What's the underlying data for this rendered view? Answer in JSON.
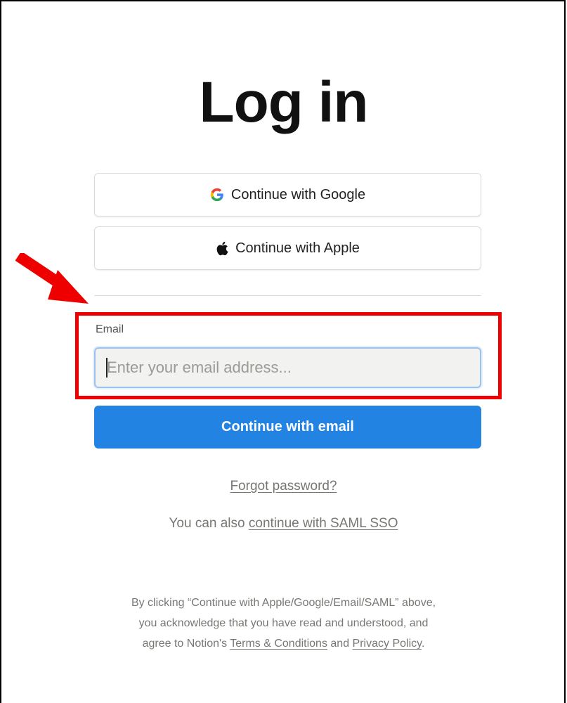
{
  "page": {
    "title": "Log in"
  },
  "oauth": {
    "google_label": "Continue with Google",
    "apple_label": "Continue with Apple"
  },
  "email": {
    "label": "Email",
    "placeholder": "Enter your email address...",
    "value": "",
    "submit_label": "Continue with email"
  },
  "links": {
    "forgot_password": "Forgot password?",
    "saml_prefix": "You can also ",
    "saml_link": "continue with SAML SSO"
  },
  "legal": {
    "line1": "By clicking “Continue with Apple/Google/Email/SAML” above,",
    "line2": "you acknowledge that you have read and understood, and",
    "line3_prefix": "agree to Notion's ",
    "terms_link": "Terms & Conditions",
    "and": " and ",
    "privacy_link": "Privacy Policy",
    "period": "."
  },
  "annotation": {
    "highlight_color": "#ee0000",
    "arrow_color": "#ee0000"
  },
  "colors": {
    "primary_button": "#2383e2",
    "input_focus_border": "#9dc2ee"
  }
}
